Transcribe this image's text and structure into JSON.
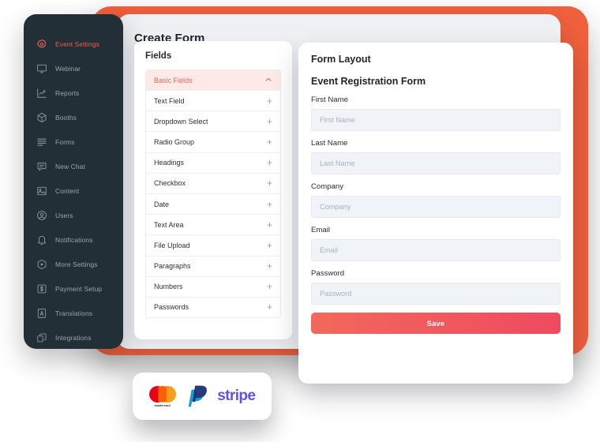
{
  "window": {
    "background_color": "#ffffff",
    "coral_color": "#f0603d",
    "content_card_color": "#eef0f4"
  },
  "sidebar": {
    "background_color": "#232f37",
    "active_color": "#ee5f51",
    "items": [
      {
        "label": "Event Settings",
        "icon": "gear-icon",
        "active": true
      },
      {
        "label": "Webinar",
        "icon": "monitor-icon",
        "active": false
      },
      {
        "label": "Reports",
        "icon": "chart-line-icon",
        "active": false
      },
      {
        "label": "Booths",
        "icon": "cube-icon",
        "active": false
      },
      {
        "label": "Forms",
        "icon": "list-lines-icon",
        "active": false
      },
      {
        "label": "New Chat",
        "icon": "chat-box-icon",
        "active": false
      },
      {
        "label": "Content",
        "icon": "image-icon",
        "active": false
      },
      {
        "label": "Users",
        "icon": "user-circle-icon",
        "active": false
      },
      {
        "label": "Notifications",
        "icon": "bell-icon",
        "active": false
      },
      {
        "label": "More Settings",
        "icon": "hexagon-dot-icon",
        "active": false
      },
      {
        "label": "Payment Setup",
        "icon": "dollar-box-icon",
        "active": false
      },
      {
        "label": "Translations",
        "icon": "letter-a-box-icon",
        "active": false
      },
      {
        "label": "Integrations",
        "icon": "layers-copy-icon",
        "active": false
      }
    ]
  },
  "content": {
    "title": "Create Form"
  },
  "fields_panel": {
    "title": "Fields",
    "group": {
      "label": "Basic Fields",
      "expanded": true,
      "chevron": "chevron-up-icon",
      "background_color": "#fdeae7",
      "text_color": "#e8655a"
    },
    "add_icon": "+",
    "items": [
      {
        "label": "Text Field"
      },
      {
        "label": "Dropdown Select"
      },
      {
        "label": "Radio Group"
      },
      {
        "label": "Headings"
      },
      {
        "label": "Checkbox"
      },
      {
        "label": "Date"
      },
      {
        "label": "Text Area"
      },
      {
        "label": "File Upload"
      },
      {
        "label": "Paragraphs"
      },
      {
        "label": "Numbers"
      },
      {
        "label": "Passwords"
      }
    ]
  },
  "form_panel": {
    "title": "Form Layout",
    "form_heading": "Event Registration Form",
    "fields": [
      {
        "label": "First Name",
        "placeholder": "First Name",
        "value": ""
      },
      {
        "label": "Last Name",
        "placeholder": "Last Name",
        "value": ""
      },
      {
        "label": "Company",
        "placeholder": "Company",
        "value": ""
      },
      {
        "label": "Email",
        "placeholder": "Email",
        "value": ""
      },
      {
        "label": "Password",
        "placeholder": "Password",
        "value": ""
      }
    ],
    "save_label": "Save",
    "save_color": "#f2685c"
  },
  "payments": {
    "logos": [
      {
        "name": "mastercard-logo",
        "text": "mastercard"
      },
      {
        "name": "paypal-logo",
        "text": ""
      },
      {
        "name": "stripe-logo",
        "text": "stripe"
      }
    ]
  }
}
